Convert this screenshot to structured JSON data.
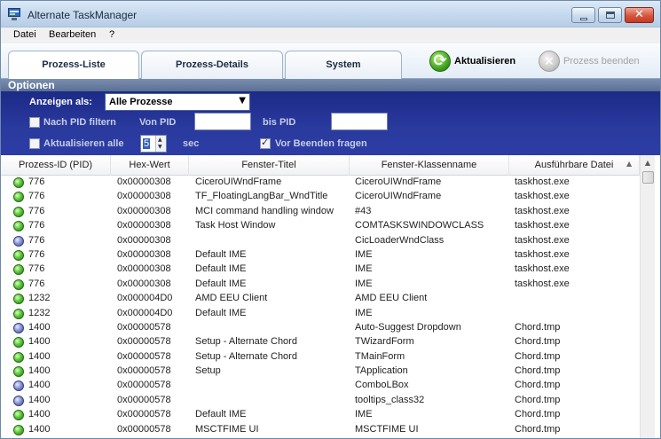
{
  "window": {
    "title": "Alternate TaskManager"
  },
  "menu": [
    "Datei",
    "Bearbeiten",
    "?"
  ],
  "tabs": [
    "Prozess-Liste",
    "Prozess-Details",
    "System"
  ],
  "toolbar": {
    "refresh": "Aktualisieren",
    "end_process": "Prozess beenden"
  },
  "options": {
    "header": "Optionen",
    "show_as_label": "Anzeigen als:",
    "show_as_value": "Alle Prozesse",
    "filter_pid_label": "Nach PID filtern",
    "from_pid_label": "Von PID",
    "to_pid_label": "bis PID",
    "refresh_every_label": "Aktualisieren alle",
    "refresh_value": "5",
    "sec_label": "sec",
    "confirm_label": "Vor Beenden fragen"
  },
  "columns": [
    "Prozess-ID (PID)",
    "Hex-Wert",
    "Fenster-Titel",
    "Fenster-Klassenname",
    "Ausführbare Datei"
  ],
  "rows": [
    {
      "status": "green",
      "pid": "776",
      "hex": "0x00000308",
      "title": "CiceroUIWndFrame",
      "class": "CiceroUIWndFrame",
      "exe": "taskhost.exe"
    },
    {
      "status": "green",
      "pid": "776",
      "hex": "0x00000308",
      "title": "TF_FloatingLangBar_WndTitle",
      "class": "CiceroUIWndFrame",
      "exe": "taskhost.exe"
    },
    {
      "status": "green",
      "pid": "776",
      "hex": "0x00000308",
      "title": "MCI command handling window",
      "class": "#43",
      "exe": "taskhost.exe"
    },
    {
      "status": "green",
      "pid": "776",
      "hex": "0x00000308",
      "title": "Task Host Window",
      "class": "COMTASKSWINDOWCLASS",
      "exe": "taskhost.exe"
    },
    {
      "status": "blue",
      "pid": "776",
      "hex": "0x00000308",
      "title": "",
      "class": "CicLoaderWndClass",
      "exe": "taskhost.exe"
    },
    {
      "status": "green",
      "pid": "776",
      "hex": "0x00000308",
      "title": "Default IME",
      "class": "IME",
      "exe": "taskhost.exe"
    },
    {
      "status": "green",
      "pid": "776",
      "hex": "0x00000308",
      "title": "Default IME",
      "class": "IME",
      "exe": "taskhost.exe"
    },
    {
      "status": "green",
      "pid": "776",
      "hex": "0x00000308",
      "title": "Default IME",
      "class": "IME",
      "exe": "taskhost.exe"
    },
    {
      "status": "green",
      "pid": "1232",
      "hex": "0x000004D0",
      "title": "AMD EEU Client",
      "class": "AMD EEU Client",
      "exe": ""
    },
    {
      "status": "green",
      "pid": "1232",
      "hex": "0x000004D0",
      "title": "Default IME",
      "class": "IME",
      "exe": ""
    },
    {
      "status": "blue",
      "pid": "1400",
      "hex": "0x00000578",
      "title": "",
      "class": "Auto-Suggest Dropdown",
      "exe": "Chord.tmp"
    },
    {
      "status": "green",
      "pid": "1400",
      "hex": "0x00000578",
      "title": "Setup - Alternate Chord",
      "class": "TWizardForm",
      "exe": "Chord.tmp"
    },
    {
      "status": "green",
      "pid": "1400",
      "hex": "0x00000578",
      "title": "Setup - Alternate Chord",
      "class": "TMainForm",
      "exe": "Chord.tmp"
    },
    {
      "status": "green",
      "pid": "1400",
      "hex": "0x00000578",
      "title": "Setup",
      "class": "TApplication",
      "exe": "Chord.tmp"
    },
    {
      "status": "blue",
      "pid": "1400",
      "hex": "0x00000578",
      "title": "",
      "class": "ComboLBox",
      "exe": "Chord.tmp"
    },
    {
      "status": "blue",
      "pid": "1400",
      "hex": "0x00000578",
      "title": "",
      "class": "tooltips_class32",
      "exe": "Chord.tmp"
    },
    {
      "status": "green",
      "pid": "1400",
      "hex": "0x00000578",
      "title": "Default IME",
      "class": "IME",
      "exe": "Chord.tmp"
    },
    {
      "status": "green",
      "pid": "1400",
      "hex": "0x00000578",
      "title": "MSCTFIME UI",
      "class": "MSCTFIME UI",
      "exe": "Chord.tmp"
    }
  ]
}
